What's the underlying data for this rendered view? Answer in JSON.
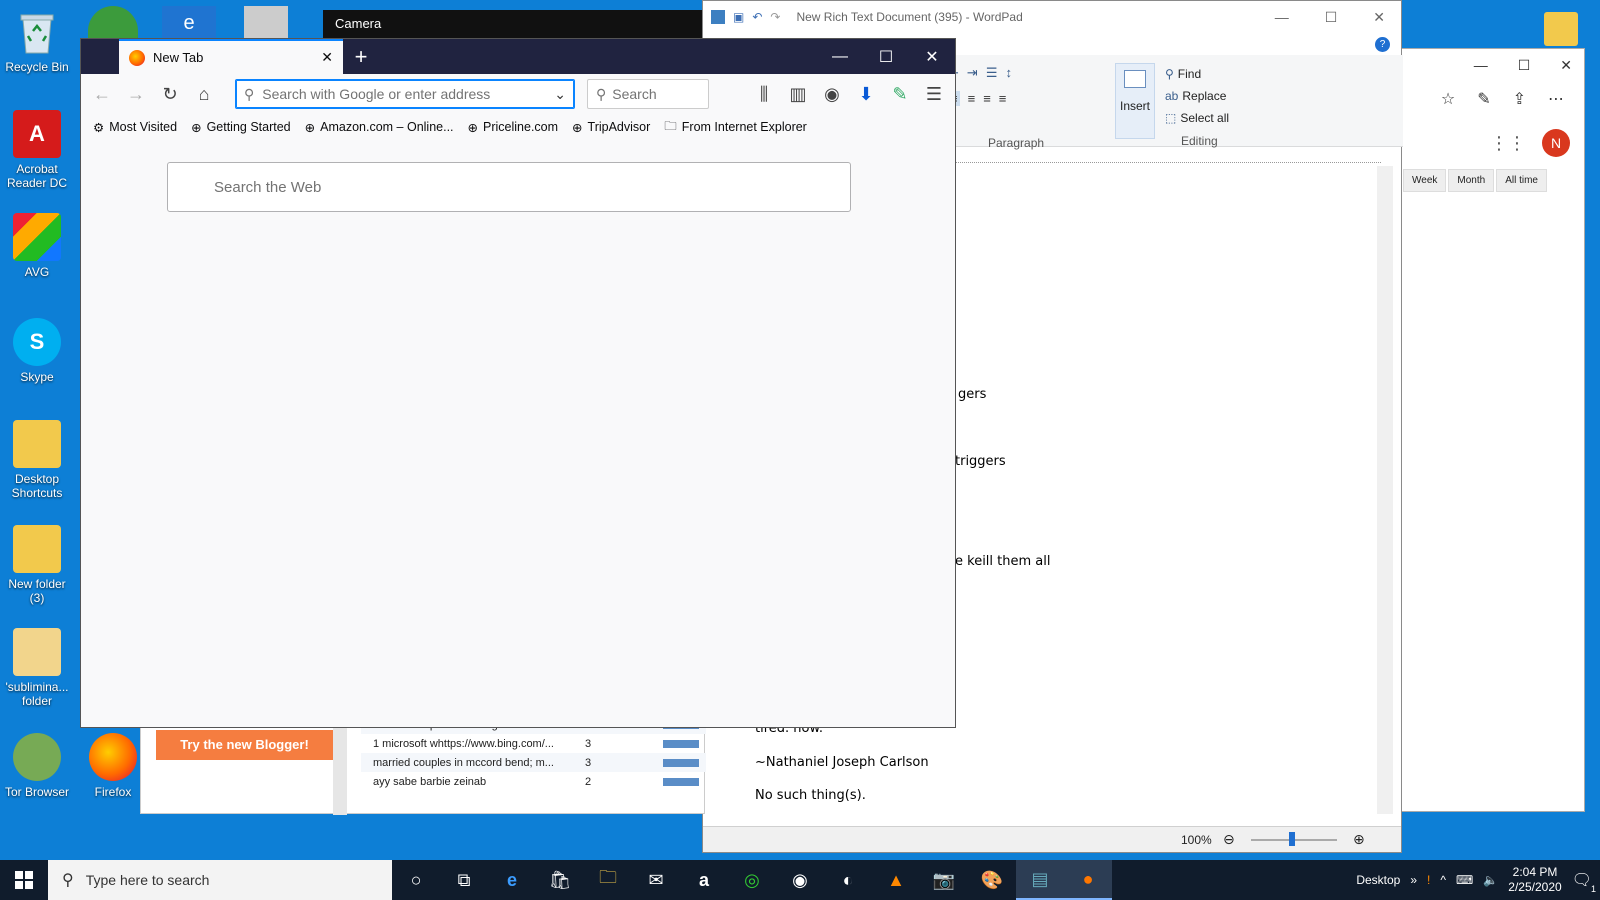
{
  "desktop": {
    "icons": [
      {
        "label": "Recycle Bin",
        "icon": "recycle-bin-icon"
      },
      {
        "label": "Acrobat Reader DC",
        "icon": "acrobat-icon"
      },
      {
        "label": "AVG",
        "icon": "avg-icon"
      },
      {
        "label": "Skype",
        "icon": "skype-icon"
      },
      {
        "label": "Desktop Shortcuts",
        "icon": "folder-icon"
      },
      {
        "label": "New folder (3)",
        "icon": "folder-icon"
      },
      {
        "label": "'sublimina... folder",
        "icon": "folder-icon"
      },
      {
        "label": "Tor Browser",
        "icon": "tor-icon"
      },
      {
        "label": "Firefox",
        "icon": "firefox-icon"
      }
    ]
  },
  "camera": {
    "title": "Camera"
  },
  "wordpad": {
    "title": "New Rich Text Document (395) - WordPad",
    "ribbon": {
      "paragraph_label": "Paragraph",
      "insert_label": "Insert",
      "editing_label": "Editing",
      "find": "Find",
      "replace": "Replace",
      "select_all": "Select all"
    },
    "doc_lines": [
      "gers",
      "triggers",
      "e keill them all",
      "tired. now.",
      "~Nathaniel Joseph Carlson",
      "No such thing(s)."
    ],
    "zoom": "100%"
  },
  "edge_window": {
    "filters": [
      "Week",
      "Month",
      "All time"
    ],
    "avatar": "N"
  },
  "blogger": {
    "button": "Try the new Blogger!",
    "rows": [
      {
        "query": "microsofthttps://www.bing.com/video...",
        "count": "4"
      },
      {
        "query": "1 microsoft whttps://www.bing.com/...",
        "count": "3"
      },
      {
        "query": "married couples in mccord bend; m...",
        "count": "3"
      },
      {
        "query": "ayy sabe barbie zeinab",
        "count": "2"
      }
    ]
  },
  "firefox": {
    "tab_title": "New Tab",
    "url_placeholder": "Search with Google or enter address",
    "search_placeholder": "Search",
    "bookmarks": [
      "Most Visited",
      "Getting Started",
      "Amazon.com – Online...",
      "Priceline.com",
      "TripAdvisor",
      "From Internet Explorer"
    ],
    "web_search_placeholder": "Search the Web"
  },
  "taskbar": {
    "search_placeholder": "Type here to search",
    "desktop_label": "Desktop",
    "time": "2:04 PM",
    "date": "2/25/2020",
    "notification_count": "1"
  }
}
